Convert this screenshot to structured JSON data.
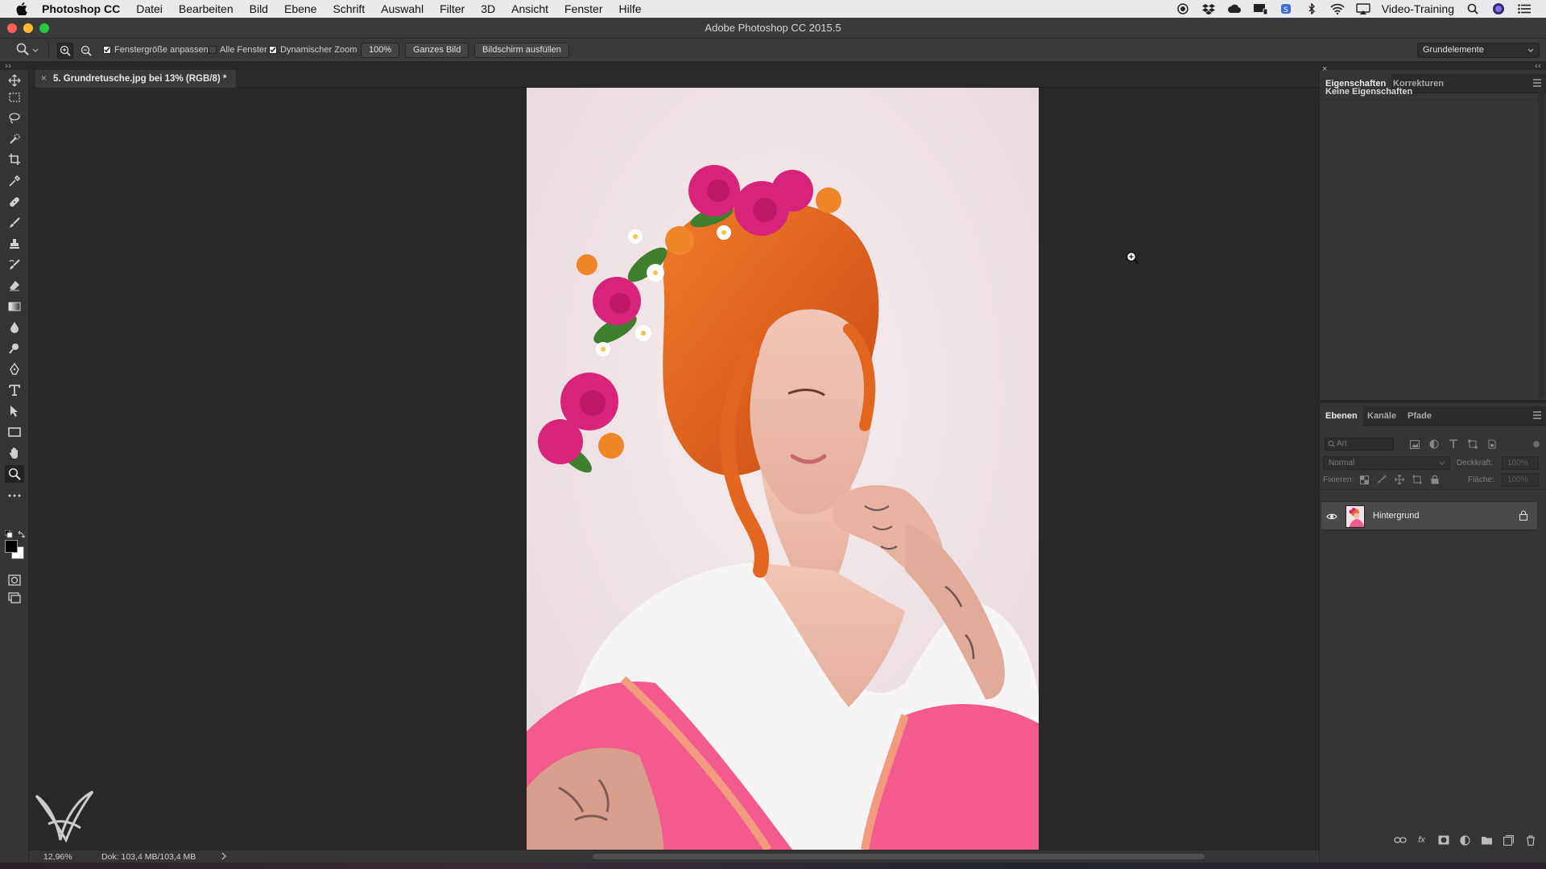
{
  "menubar": {
    "app_name": "Photoshop CC",
    "items": [
      "Datei",
      "Bearbeiten",
      "Bild",
      "Ebene",
      "Schrift",
      "Auswahl",
      "Filter",
      "3D",
      "Ansicht",
      "Fenster",
      "Hilfe"
    ],
    "user": "Video-Training"
  },
  "window": {
    "title": "Adobe Photoshop CC 2015.5"
  },
  "options": {
    "fit_window_label": "Fenstergröße anpassen",
    "fit_window_checked": true,
    "all_windows_label": "Alle Fenster",
    "all_windows_checked": false,
    "dynamic_zoom_label": "Dynamischer Zoom",
    "dynamic_zoom_checked": true,
    "btn_100": "100%",
    "btn_fit": "Ganzes Bild",
    "btn_fill": "Bildschirm ausfüllen",
    "workspace": "Grundelemente"
  },
  "document": {
    "tab_title": "5. Grundretusche.jpg bei 13% (RGB/8) *"
  },
  "status": {
    "zoom": "12,96%",
    "doc_info": "Dok: 103,4 MB/103,4 MB"
  },
  "properties_panel": {
    "tabs": [
      "Eigenschaften",
      "Korrekturen"
    ],
    "empty_text": "Keine Eigenschaften"
  },
  "layers_panel": {
    "tabs": [
      "Ebenen",
      "Kanäle",
      "Pfade"
    ],
    "filter_placeholder": "Art",
    "blend_mode": "Normal",
    "opacity_label": "Deckkraft:",
    "opacity_value": "100%",
    "lock_label": "Fixieren:",
    "fill_label": "Fläche:",
    "fill_value": "100%",
    "layers": [
      {
        "name": "Hintergrund",
        "visible": true,
        "locked": true
      }
    ]
  },
  "colors": {
    "menubar_bg": "#e9e9eb",
    "canvas_bg": "#282828",
    "panel_bg": "#353535",
    "traffic_red": "#fe5f57",
    "traffic_yellow": "#febb2e",
    "traffic_green": "#27c840"
  }
}
